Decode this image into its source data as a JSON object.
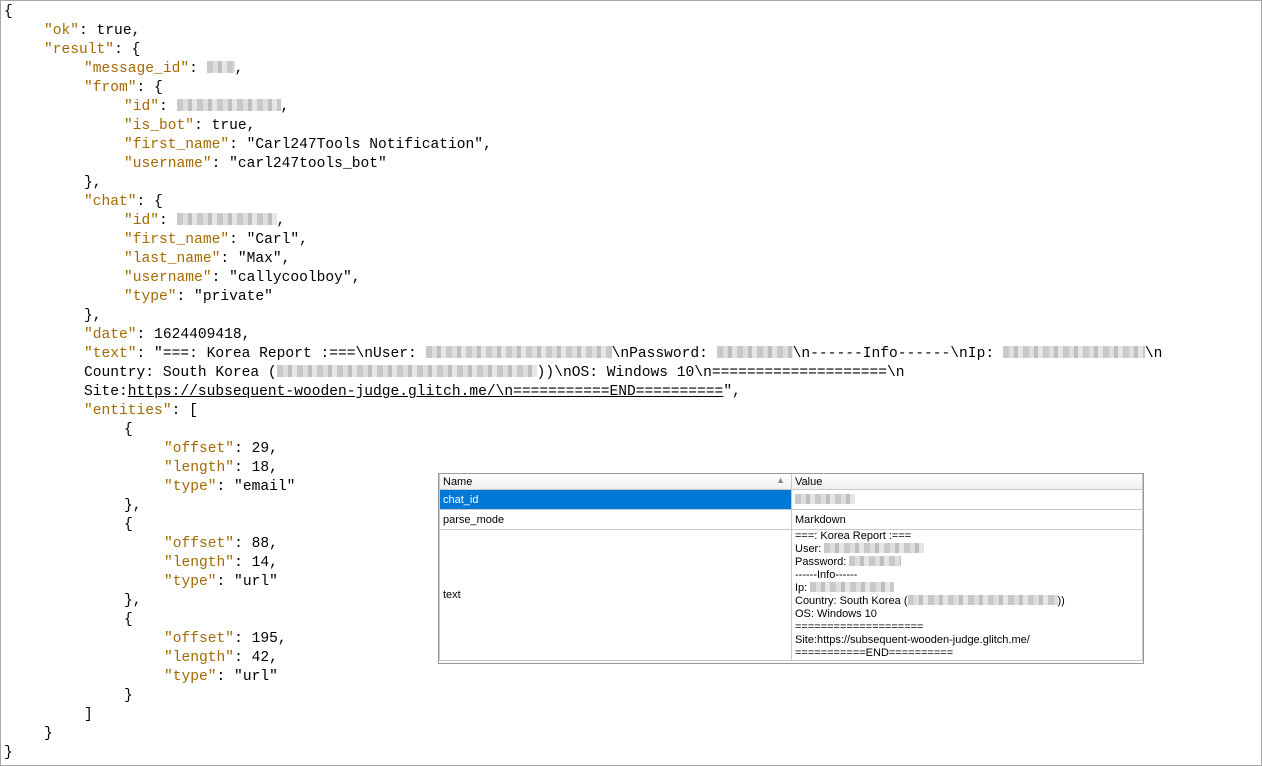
{
  "json_lines": [
    {
      "i": 0,
      "parts": [
        {
          "t": "{"
        }
      ]
    },
    {
      "i": 1,
      "parts": [
        {
          "k": "\"ok\""
        },
        {
          "t": ": true,"
        }
      ]
    },
    {
      "i": 1,
      "parts": [
        {
          "k": "\"result\""
        },
        {
          "t": ": {"
        }
      ]
    },
    {
      "i": 2,
      "parts": [
        {
          "k": "\"message_id\""
        },
        {
          "t": ": "
        },
        {
          "b": 28
        },
        {
          "t": ","
        }
      ]
    },
    {
      "i": 2,
      "parts": [
        {
          "k": "\"from\""
        },
        {
          "t": ": {"
        }
      ]
    },
    {
      "i": 3,
      "parts": [
        {
          "k": "\"id\""
        },
        {
          "t": ": "
        },
        {
          "b": 104
        },
        {
          "t": ","
        }
      ]
    },
    {
      "i": 3,
      "parts": [
        {
          "k": "\"is_bot\""
        },
        {
          "t": ": true,"
        }
      ]
    },
    {
      "i": 3,
      "parts": [
        {
          "k": "\"first_name\""
        },
        {
          "t": ": \"Carl247Tools Notification\","
        }
      ]
    },
    {
      "i": 3,
      "parts": [
        {
          "k": "\"username\""
        },
        {
          "t": ": \"carl247tools_bot\""
        }
      ]
    },
    {
      "i": 2,
      "parts": [
        {
          "t": "},"
        }
      ]
    },
    {
      "i": 2,
      "parts": [
        {
          "k": "\"chat\""
        },
        {
          "t": ": {"
        }
      ]
    },
    {
      "i": 3,
      "parts": [
        {
          "k": "\"id\""
        },
        {
          "t": ": "
        },
        {
          "b": 100
        },
        {
          "t": ","
        }
      ]
    },
    {
      "i": 3,
      "parts": [
        {
          "k": "\"first_name\""
        },
        {
          "t": ": \"Carl\","
        }
      ]
    },
    {
      "i": 3,
      "parts": [
        {
          "k": "\"last_name\""
        },
        {
          "t": ": \"Max\","
        }
      ]
    },
    {
      "i": 3,
      "parts": [
        {
          "k": "\"username\""
        },
        {
          "t": ": \"callycoolboy\","
        }
      ]
    },
    {
      "i": 3,
      "parts": [
        {
          "k": "\"type\""
        },
        {
          "t": ": \"private\""
        }
      ]
    },
    {
      "i": 2,
      "parts": [
        {
          "t": "},"
        }
      ]
    },
    {
      "i": 2,
      "parts": [
        {
          "k": "\"date\""
        },
        {
          "t": ": 1624409418,"
        }
      ]
    },
    {
      "i": 2,
      "parts": [
        {
          "k": "\"text\""
        },
        {
          "t": ": \"===: Korea Report :===\\nUser: "
        },
        {
          "b": 186
        },
        {
          "t": "\\nPassword: "
        },
        {
          "b": 76
        },
        {
          "t": "\\n------Info------\\nIp: "
        },
        {
          "b": 142
        },
        {
          "t": "\\n"
        }
      ]
    },
    {
      "i": 2,
      "parts": [
        {
          "t": "Country: South Korea ("
        },
        {
          "b": 260
        },
        {
          "t": "))\\nOS: Windows 10\\n====================\\n"
        }
      ]
    },
    {
      "i": 2,
      "parts": [
        {
          "t": "Site:"
        },
        {
          "u": "https://subsequent-wooden-judge.glitch.me/\\n===========END=========="
        },
        {
          "t": "\","
        }
      ]
    },
    {
      "i": 2,
      "parts": [
        {
          "k": "\"entities\""
        },
        {
          "t": ": ["
        }
      ]
    },
    {
      "i": 3,
      "parts": [
        {
          "t": "{"
        }
      ]
    },
    {
      "i": 4,
      "parts": [
        {
          "k": "\"offset\""
        },
        {
          "t": ": 29,"
        }
      ]
    },
    {
      "i": 4,
      "parts": [
        {
          "k": "\"length\""
        },
        {
          "t": ": 18,"
        }
      ]
    },
    {
      "i": 4,
      "parts": [
        {
          "k": "\"type\""
        },
        {
          "t": ": \"email\""
        }
      ]
    },
    {
      "i": 3,
      "parts": [
        {
          "t": "},"
        }
      ]
    },
    {
      "i": 3,
      "parts": [
        {
          "t": "{"
        }
      ]
    },
    {
      "i": 4,
      "parts": [
        {
          "k": "\"offset\""
        },
        {
          "t": ": 88,"
        }
      ]
    },
    {
      "i": 4,
      "parts": [
        {
          "k": "\"length\""
        },
        {
          "t": ": 14,"
        }
      ]
    },
    {
      "i": 4,
      "parts": [
        {
          "k": "\"type\""
        },
        {
          "t": ": \"url\""
        }
      ]
    },
    {
      "i": 3,
      "parts": [
        {
          "t": "},"
        }
      ]
    },
    {
      "i": 3,
      "parts": [
        {
          "t": "{"
        }
      ]
    },
    {
      "i": 4,
      "parts": [
        {
          "k": "\"offset\""
        },
        {
          "t": ": 195,"
        }
      ]
    },
    {
      "i": 4,
      "parts": [
        {
          "k": "\"length\""
        },
        {
          "t": ": 42,"
        }
      ]
    },
    {
      "i": 4,
      "parts": [
        {
          "k": "\"type\""
        },
        {
          "t": ": \"url\""
        }
      ]
    },
    {
      "i": 3,
      "parts": [
        {
          "t": "}"
        }
      ]
    },
    {
      "i": 2,
      "parts": [
        {
          "t": "]"
        }
      ]
    },
    {
      "i": 1,
      "parts": [
        {
          "t": "}"
        }
      ]
    },
    {
      "i": 0,
      "parts": [
        {
          "t": "}"
        }
      ]
    }
  ],
  "grid": {
    "header_name": "Name",
    "header_value": "Value",
    "sort_icon": "▲",
    "rows": [
      {
        "name": "chat_id",
        "value": "",
        "redacted": true
      },
      {
        "name": "parse_mode",
        "value": "Markdown"
      },
      {
        "name": "text"
      }
    ],
    "text_value_lines": [
      {
        "t": "===: Korea Report :==="
      },
      {
        "t": "User: ",
        "b": 100
      },
      {
        "t": "Password: ",
        "b": 52
      },
      {
        "t": "------Info------"
      },
      {
        "t": "Ip: ",
        "b": 84
      },
      {
        "t": "Country: South Korea (",
        "b": 150,
        "after": "))"
      },
      {
        "t": "OS: Windows 10"
      },
      {
        "t": "===================="
      },
      {
        "t": "Site:https://subsequent-wooden-judge.glitch.me/"
      },
      {
        "t": "===========END=========="
      }
    ]
  },
  "colors": {
    "key": "#a36a00",
    "selection": "#0078d7"
  }
}
